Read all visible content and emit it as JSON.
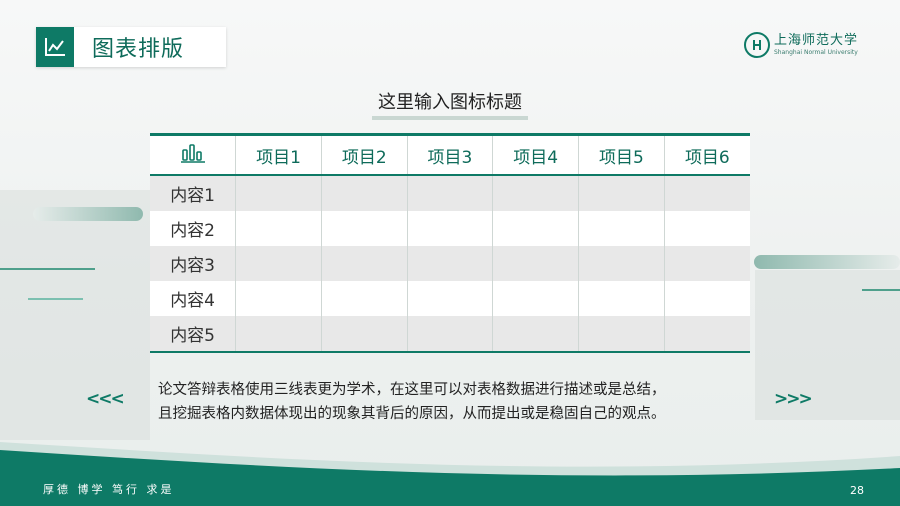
{
  "header": {
    "title": "图表排版"
  },
  "logo": {
    "name_cn": "上海师范大学",
    "name_en": "Shanghai Normal University"
  },
  "chart_title": "这里输入图标标题",
  "table": {
    "columns": [
      "项目1",
      "项目2",
      "项目3",
      "项目4",
      "项目5",
      "项目6"
    ],
    "rows": [
      "内容1",
      "内容2",
      "内容3",
      "内容4",
      "内容5"
    ]
  },
  "description": {
    "line1": "论文答辩表格使用三线表更为学术，在这里可以对表格数据进行描述或是总结，",
    "line2": "且挖掘表格内数据体现出的现象其背后的原因，从而提出或是稳固自己的观点。"
  },
  "arrows": {
    "left": "<<<",
    "right": ">>>"
  },
  "footer": {
    "motto": "厚德 博学 笃行 求是",
    "page": "28"
  },
  "colors": {
    "accent": "#0e7a66",
    "accent_light": "#7cc0b0"
  }
}
